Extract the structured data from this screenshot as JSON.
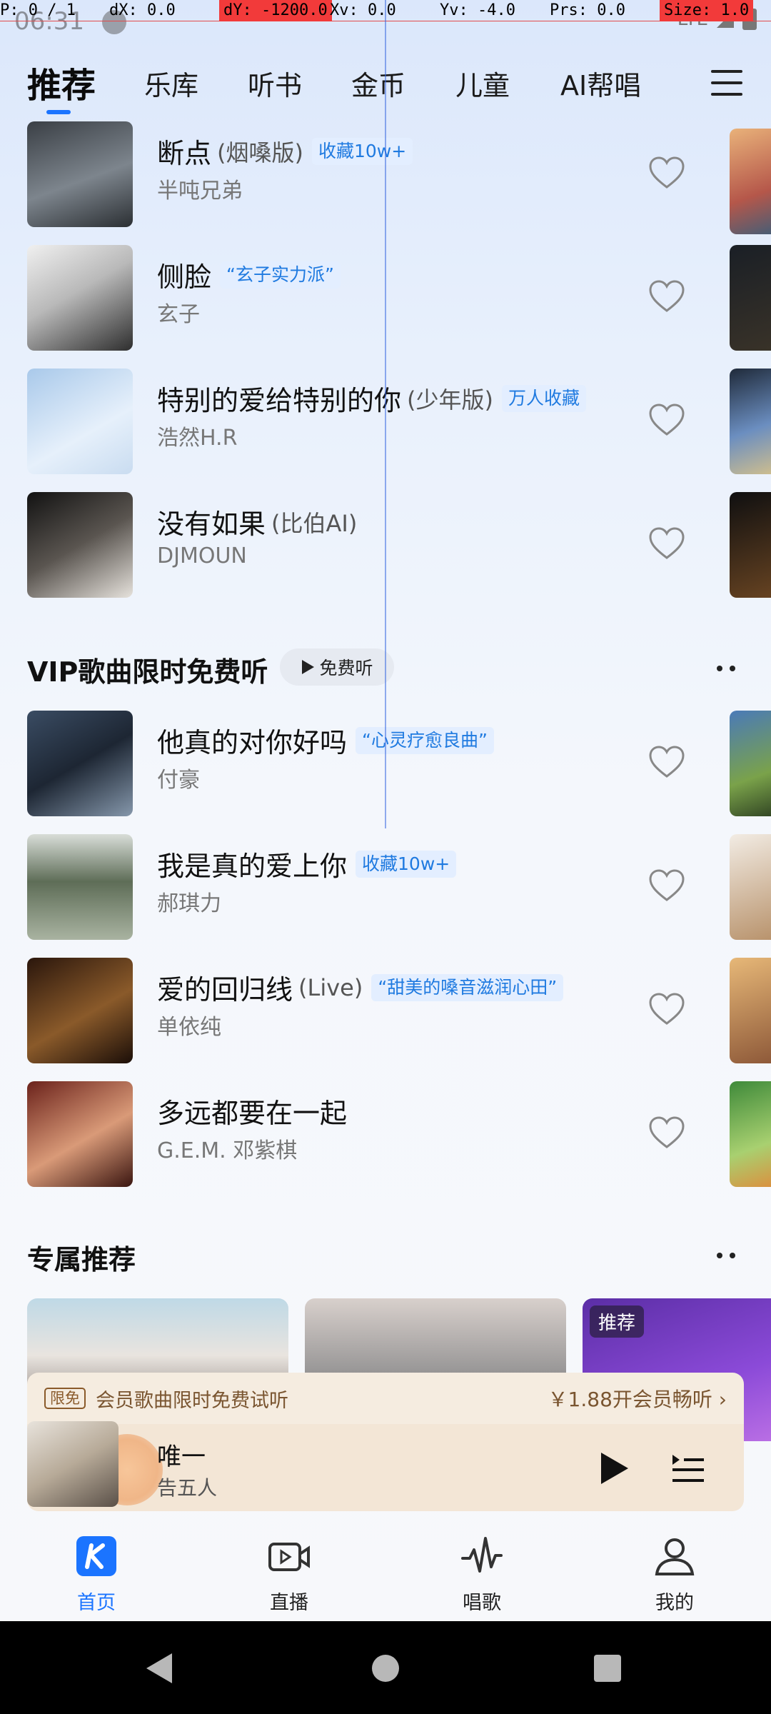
{
  "debug": {
    "p": "P: 0 / 1",
    "dx": "dX: 0.0",
    "dy": "dY: -1200.0",
    "xv": "Xv: 0.0",
    "yv": "Yv: -4.0",
    "prs": "Prs: 0.0",
    "size": "Size: 1.0"
  },
  "status": {
    "time": "06:31",
    "network": "LTE"
  },
  "tabs": {
    "items": [
      "推荐",
      "乐库",
      "听书",
      "金币",
      "儿童",
      "AI帮唱"
    ],
    "active": "推荐"
  },
  "songs_top": [
    {
      "title": "断点",
      "version": "(烟嗓版)",
      "tag": "收藏10w+",
      "artist": "半吨兄弟",
      "cover_colors": [
        "#2d3238",
        "#8d9298"
      ]
    },
    {
      "title": "侧脸",
      "version": "",
      "tag": "“玄子实力派”",
      "artist": "玄子",
      "cover_colors": [
        "#e8e8e8",
        "#303030"
      ]
    },
    {
      "title": "特别的爱给特别的你",
      "version": "(少年版)",
      "tag": "万人收藏",
      "artist": "浩然H.R",
      "cover_colors": [
        "#b9d4ee",
        "#e8f1fb"
      ]
    },
    {
      "title": "没有如果",
      "version": "(比伯AI)",
      "tag": "",
      "artist": "DJMOUN",
      "cover_colors": [
        "#141414",
        "#cfcac4"
      ]
    }
  ],
  "vip_section": {
    "title": "VIP歌曲限时免费听",
    "free_button": "免费听"
  },
  "songs_vip": [
    {
      "title": "他真的对你好吗",
      "version": "",
      "tag": "“心灵疗愈良曲”",
      "artist": "付豪",
      "cover_colors": [
        "#2f3e52",
        "#7f8fa0"
      ]
    },
    {
      "title": "我是真的爱上你",
      "version": "",
      "tag": "收藏10w+",
      "artist": "郝琪力",
      "cover_colors": [
        "#6d7a66",
        "#dfe3dc"
      ]
    },
    {
      "title": "爱的回归线",
      "version": "(Live)",
      "tag": "“甜美的嗓音滋润心田”",
      "artist": "单依纯",
      "cover_colors": [
        "#3b2214",
        "#c79a57"
      ]
    },
    {
      "title": "多远都要在一起",
      "version": "",
      "tag": "",
      "artist": "G.E.M. 邓紫棋",
      "cover_colors": [
        "#7a2c24",
        "#e8b08c"
      ]
    }
  ],
  "exclusive": {
    "title": "专属推荐",
    "card_tag": "推荐"
  },
  "vip_bar": {
    "badge": "限免",
    "text": "会员歌曲限时免费试听",
    "price": "￥1.88开会员畅听 ›"
  },
  "player": {
    "title": "唯一",
    "artist": "告五人"
  },
  "bottom_nav": [
    {
      "label": "首页",
      "icon": "home-k-icon",
      "active": true
    },
    {
      "label": "直播",
      "icon": "live-video-icon",
      "active": false
    },
    {
      "label": "唱歌",
      "icon": "sing-wave-icon",
      "active": false
    },
    {
      "label": "我的",
      "icon": "profile-icon",
      "active": false
    }
  ],
  "colors": {
    "accent": "#1b74ff",
    "tag_blue": "#1f7ae0",
    "vip_gold": "#7a5530"
  }
}
